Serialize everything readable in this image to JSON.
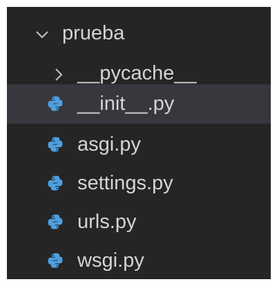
{
  "explorer": {
    "folder": {
      "label": "prueba",
      "expanded": true,
      "chevron_icon": "chevron-down-icon"
    },
    "items": [
      {
        "label": "__pycache__",
        "type": "folder",
        "icon": "chevron-right-icon",
        "selected": false
      },
      {
        "label": "__init__.py",
        "type": "python-file",
        "icon": "python-icon",
        "selected": true
      },
      {
        "label": "asgi.py",
        "type": "python-file",
        "icon": "python-icon",
        "selected": false
      },
      {
        "label": "settings.py",
        "type": "python-file",
        "icon": "python-icon",
        "selected": false
      },
      {
        "label": "urls.py",
        "type": "python-file",
        "icon": "python-icon",
        "selected": false
      },
      {
        "label": "wsgi.py",
        "type": "python-file",
        "icon": "python-icon",
        "selected": false
      }
    ]
  },
  "colors": {
    "background": "#252526",
    "selected_row": "#37373d",
    "text": "#d4d4d4",
    "chevron": "#c5c5c5",
    "python_icon": "#4d9fdf"
  }
}
